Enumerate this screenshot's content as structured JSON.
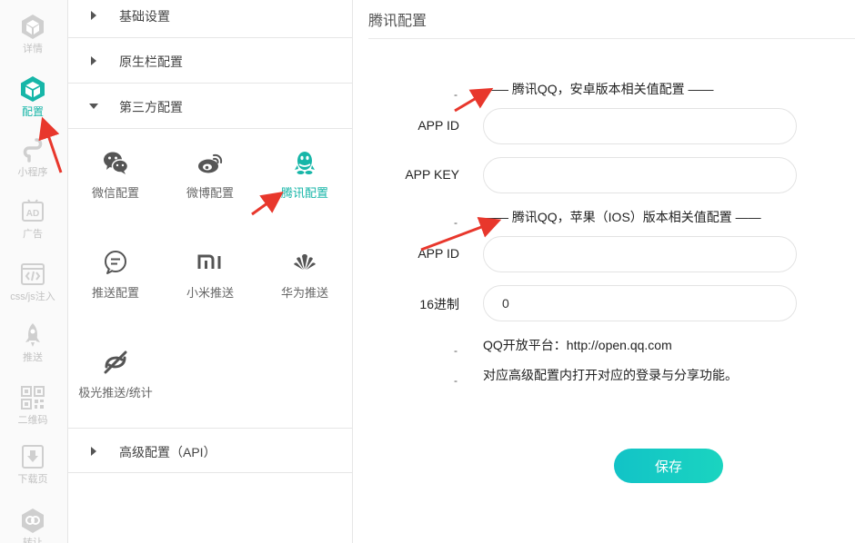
{
  "colors": {
    "accent": "#17b6a8",
    "button": "#16cbc4",
    "arrow": "#e8372c",
    "muted": "#c2c2c2"
  },
  "rail": [
    {
      "id": "detail",
      "label": "详情",
      "icon": "hexagon-cube-icon"
    },
    {
      "id": "config",
      "label": "配置",
      "icon": "cube-icon",
      "active": true
    },
    {
      "id": "mini",
      "label": "小程序",
      "icon": "mini-program-icon"
    },
    {
      "id": "ad",
      "label": "广告",
      "icon": "ad-icon"
    },
    {
      "id": "css",
      "label": "css/js注入",
      "icon": "code-icon"
    },
    {
      "id": "push",
      "label": "推送",
      "icon": "rocket-icon"
    },
    {
      "id": "qr",
      "label": "二维码",
      "icon": "qr-code-icon"
    },
    {
      "id": "download",
      "label": "下载页",
      "icon": "download-page-icon"
    },
    {
      "id": "convert",
      "label": "转让",
      "icon": "convert-icon"
    }
  ],
  "sections": {
    "basic": "基础设置",
    "native_bar": "原生栏配置",
    "third_party": "第三方配置",
    "advanced": "高级配置（API）"
  },
  "tiles": [
    {
      "label": "微信配置",
      "icon": "wechat-icon"
    },
    {
      "label": "微博配置",
      "icon": "weibo-icon"
    },
    {
      "label": "腾讯配置",
      "icon": "qq-icon",
      "active": true
    },
    {
      "label": "推送配置",
      "icon": "chat-bubble-icon"
    },
    {
      "label": "小米推送",
      "icon": "xiaomi-icon"
    },
    {
      "label": "华为推送",
      "icon": "huawei-icon"
    },
    {
      "label": "极光推送/统计",
      "icon": "jiguang-icon"
    }
  ],
  "main": {
    "title": "腾讯配置",
    "android_note": "—— 腾讯QQ，安卓版本相关值配置 ——",
    "ios_note": "—— 腾讯QQ，苹果（IOS）版本相关值配置 ——",
    "dash": "-",
    "fields": {
      "android_app_id": {
        "label": "APP ID",
        "value": ""
      },
      "android_app_key": {
        "label": "APP KEY",
        "value": ""
      },
      "ios_app_id": {
        "label": "APP ID",
        "value": ""
      },
      "ios_hex": {
        "label": "16进制",
        "value": "0"
      }
    },
    "info1": "QQ开放平台：http://open.qq.com",
    "info2": "对应高级配置内打开对应的登录与分享功能。",
    "save_label": "保存"
  }
}
